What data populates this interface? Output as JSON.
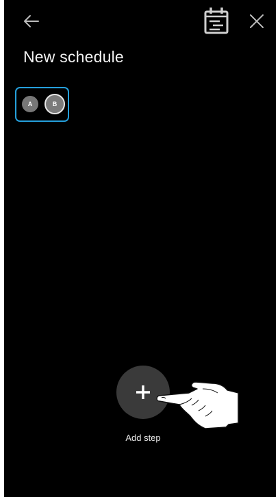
{
  "header": {
    "back_icon": "arrow-left-icon",
    "calendar_icon": "calendar-notes-icon",
    "close_icon": "close-icon"
  },
  "page": {
    "title": "New schedule"
  },
  "ab_selector": {
    "option_a": "A",
    "option_b": "B",
    "selected": "B",
    "accent_color": "#25a0dc"
  },
  "add_step": {
    "icon": "plus-icon",
    "label": "Add step"
  },
  "overlay": {
    "icon": "pointing-hand-icon"
  }
}
